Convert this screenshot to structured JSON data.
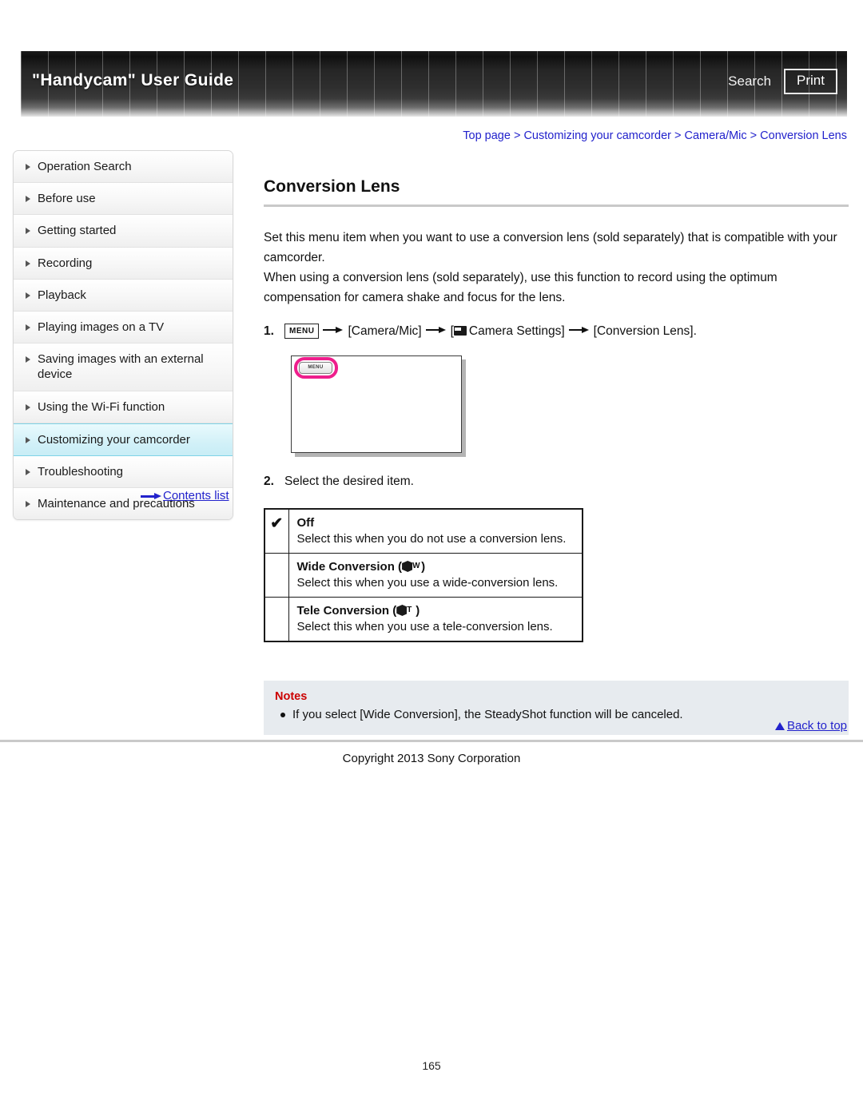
{
  "header": {
    "title": "\"Handycam\" User Guide",
    "search_label": "Search",
    "print_label": "Print"
  },
  "breadcrumb": {
    "full": "Top page > Customizing your camcorder > Camera/Mic > Conversion Lens",
    "items": [
      "Top page",
      "Customizing your camcorder",
      "Camera/Mic",
      "Conversion Lens"
    ]
  },
  "sidebar": {
    "items": [
      {
        "label": "Operation Search",
        "active": false
      },
      {
        "label": "Before use",
        "active": false
      },
      {
        "label": "Getting started",
        "active": false
      },
      {
        "label": "Recording",
        "active": false
      },
      {
        "label": "Playback",
        "active": false
      },
      {
        "label": "Playing images on a TV",
        "active": false
      },
      {
        "label": "Saving images with an external device",
        "active": false
      },
      {
        "label": "Using the Wi-Fi function",
        "active": false
      },
      {
        "label": "Customizing your camcorder",
        "active": true
      },
      {
        "label": "Troubleshooting",
        "active": false
      },
      {
        "label": "Maintenance and precautions",
        "active": false
      }
    ],
    "contents_link": "Contents list"
  },
  "main": {
    "title": "Conversion Lens",
    "paragraph1": "Set this menu item when you want to use a conversion lens (sold separately) that is compatible with your camcorder.",
    "paragraph2": "When using a conversion lens (sold separately), use this function to record using the optimum compensation for camera shake and focus for the lens.",
    "steps": [
      {
        "number": "1.",
        "menu_chip": "MENU",
        "part1": "[Camera/Mic]",
        "part2_prefix": "[",
        "part2": "Camera Settings]",
        "part3": "[Conversion Lens]."
      },
      {
        "number": "2.",
        "text": "Select the desired item."
      }
    ],
    "screenshot": {
      "menu_button_label": "MENU",
      "highlight_color": "#ee1e8c"
    },
    "options": [
      {
        "checked": true,
        "check_glyph": "✔",
        "name": "Off",
        "icon_letter": "",
        "has_icon": false,
        "description": "Select this when you do not use a conversion lens."
      },
      {
        "checked": false,
        "check_glyph": "",
        "name": "Wide Conversion",
        "icon_letter": "W",
        "has_icon": true,
        "description": "Select this when you use a wide-conversion lens."
      },
      {
        "checked": false,
        "check_glyph": "",
        "name": "Tele Conversion",
        "icon_letter": "T",
        "has_icon": true,
        "description": "Select this when you use a tele-conversion lens."
      }
    ],
    "notes": {
      "title": "Notes",
      "items": [
        "If you select [Wide Conversion], the SteadyShot function will be canceled."
      ]
    }
  },
  "footer": {
    "back_to_top": "Back to top",
    "copyright": "Copyright 2013 Sony Corporation",
    "page_number": "165"
  }
}
